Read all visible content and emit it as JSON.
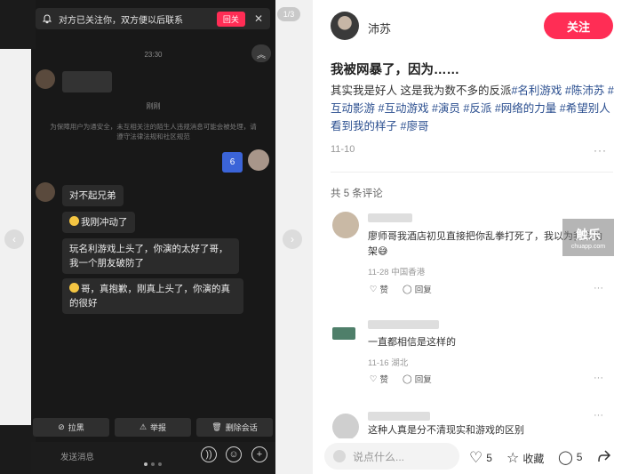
{
  "chat": {
    "notice_text": "对方已关注你，双方便以后联系",
    "notice_follow": "回关",
    "notice_close": "✕",
    "pager": "1/3",
    "time1": "23:30",
    "time2": "刚刚",
    "system_tip": "为保障用户为通安全，未互相关注的陌生人违规消息可能会被处理，请遵守法律法规和社区规范",
    "sent_number": "6",
    "msg1": "对不起兄弟",
    "msg2": "我刚冲动了",
    "msg3": "玩名利游戏上头了，你演的太好了哥，我一个朋友破防了",
    "msg4": "哥，真抱歉，刚真上头了，你演的真的很好",
    "btn_block": "拉黑",
    "btn_report": "举报",
    "btn_delete": "删除会话",
    "input_placeholder": "发送消息"
  },
  "post": {
    "author": "沛苏",
    "follow": "关注",
    "title": "我被网暴了，因为……",
    "body_plain": "其实我是好人 这是我为数不多的反派",
    "tags": [
      "#名利游戏",
      "#陈沛苏",
      "#互动影游",
      "#互动游戏",
      "#演员",
      "#反派",
      "#网络的力量",
      "#希望别人看到我的样子",
      "#廖哥"
    ],
    "date": "11-10",
    "comment_count": "共 5 条评论"
  },
  "comments": [
    {
      "text": "廖师哥我酒店初见直接把你乱拳打死了，我以为我会劝架😅",
      "meta": "11-28 中国香港",
      "like": "赞",
      "reply": "回复"
    },
    {
      "text": "一直都相信是这样的",
      "meta": "11-16 湖北",
      "like": "赞",
      "reply": "回复"
    },
    {
      "text": "这种人真是分不清现实和游戏的区别"
    }
  ],
  "watermark": {
    "main": "触乐",
    "sub": "chuapp.com"
  },
  "bottom": {
    "placeholder": "说点什么...",
    "likes": "5",
    "fav": "收藏",
    "comments": "5"
  },
  "colors": {
    "accent": "#ff2d55",
    "tag": "#2a4e8f",
    "chat_bg": "#181818",
    "sent_bubble": "#3b64d8"
  }
}
